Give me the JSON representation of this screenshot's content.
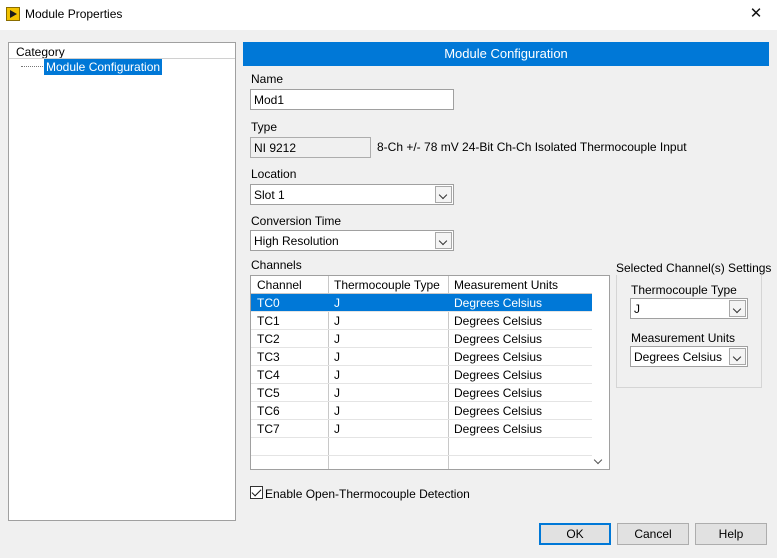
{
  "window": {
    "title": "Module Properties",
    "close_glyph": "✕"
  },
  "category": {
    "header": "Category",
    "items": [
      {
        "label": "Module Configuration",
        "selected": true
      }
    ]
  },
  "config": {
    "header": "Module Configuration",
    "name_label": "Name",
    "name_value": "Mod1",
    "type_label": "Type",
    "type_value": "NI 9212",
    "type_description": "8-Ch +/- 78 mV 24-Bit Ch-Ch Isolated Thermocouple Input",
    "location_label": "Location",
    "location_value": "Slot 1",
    "conversion_label": "Conversion Time",
    "conversion_value": "High Resolution"
  },
  "channels": {
    "label": "Channels",
    "columns": [
      "Channel",
      "Thermocouple Type",
      "Measurement Units"
    ],
    "rows": [
      {
        "channel": "TC0",
        "tc_type": "J",
        "units": "Degrees Celsius",
        "selected": true
      },
      {
        "channel": "TC1",
        "tc_type": "J",
        "units": "Degrees Celsius"
      },
      {
        "channel": "TC2",
        "tc_type": "J",
        "units": "Degrees Celsius"
      },
      {
        "channel": "TC3",
        "tc_type": "J",
        "units": "Degrees Celsius"
      },
      {
        "channel": "TC4",
        "tc_type": "J",
        "units": "Degrees Celsius"
      },
      {
        "channel": "TC5",
        "tc_type": "J",
        "units": "Degrees Celsius"
      },
      {
        "channel": "TC6",
        "tc_type": "J",
        "units": "Degrees Celsius"
      },
      {
        "channel": "TC7",
        "tc_type": "J",
        "units": "Degrees Celsius"
      }
    ]
  },
  "selected_settings": {
    "label": "Selected Channel(s) Settings",
    "tc_type_label": "Thermocouple Type",
    "tc_type_value": "J",
    "units_label": "Measurement Units",
    "units_value": "Degrees Celsius"
  },
  "open_tc": {
    "label": "Enable Open-Thermocouple Detection",
    "checked": true
  },
  "buttons": {
    "ok": "OK",
    "cancel": "Cancel",
    "help": "Help"
  },
  "colors": {
    "accent": "#0078d7",
    "window_bg": "#f0f0f0"
  }
}
